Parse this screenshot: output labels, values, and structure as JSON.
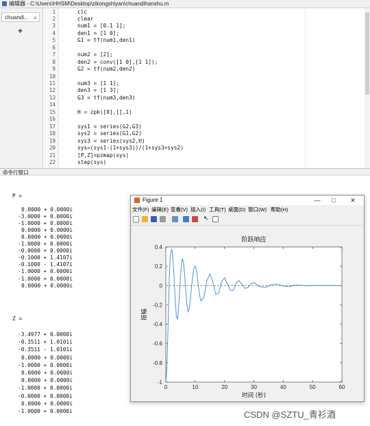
{
  "window": {
    "title": "编辑器 - C:\\Users\\HHSM\\Desktop\\zikongshiyan\\chuandihanshu.m",
    "tab_label": "chuandi...",
    "tab_close": "×",
    "add_tab": "+"
  },
  "editor": {
    "lines": [
      {
        "n": "1",
        "code": "clc"
      },
      {
        "n": "2",
        "code": "clear"
      },
      {
        "n": "3",
        "code": "num1 = [0.1 1];"
      },
      {
        "n": "4",
        "code": "den1 = [1 0];"
      },
      {
        "n": "5",
        "code": "G1 = tf(num1,den1)"
      },
      {
        "n": "6",
        "code": ""
      },
      {
        "n": "7",
        "code": "num2 = [2];"
      },
      {
        "n": "8",
        "code": "den2 = conv([1 0],[1 1]);"
      },
      {
        "n": "9",
        "code": "G2 = tf(num2,den2)"
      },
      {
        "n": "10",
        "code": ""
      },
      {
        "n": "11",
        "code": "num3 = [1 1];"
      },
      {
        "n": "12",
        "code": "den3 = [1 3];"
      },
      {
        "n": "13",
        "code": "G3 = tf(num3,den3)"
      },
      {
        "n": "14",
        "code": ""
      },
      {
        "n": "15",
        "code": "H = zpk([0],[],1)"
      },
      {
        "n": "16",
        "code": ""
      },
      {
        "n": "17",
        "code": "sys1 = series(G2,G3)"
      },
      {
        "n": "18",
        "code": "sys2 = series(G1,G2)"
      },
      {
        "n": "19",
        "code": "sys3 = series(sys2,H)"
      },
      {
        "n": "20",
        "code": "sys=(sys1-(1+sys3))/(1+sys3+sys2)"
      },
      {
        "n": "21",
        "code": "[P,Z]=pzmap(sys)"
      },
      {
        "n": "22",
        "code": "step(sys)"
      }
    ]
  },
  "command_window": {
    "title": "命令行窗口",
    "p_label": "P =",
    "p_values": [
      "0.0000 + 0.0000i",
      "-3.0000 + 0.0000i",
      "-1.0000 + 0.0000i",
      "0.0000 + 0.0000i",
      "0.0000 + 0.0000i",
      "-1.0000 + 0.0000i",
      "-0.0000 + 0.0000i",
      "-0.1000 + 1.4107i",
      "-0.1000 - 1.4107i",
      "-1.0000 + 0.0000i",
      "-1.0000 + 0.0000i",
      "0.0000 + 0.0000i"
    ],
    "z_label": "Z =",
    "z_values": [
      "-3.4977 + 0.0000i",
      "-0.3511 + 1.0101i",
      "-0.3511 - 1.0101i",
      "0.0000 + 0.0000i",
      "-1.0000 + 0.0000i",
      "0.0000 + 0.0000i",
      "0.0000 + 0.0000i",
      "-1.0000 + 0.0000i",
      "-0.0000 + 0.0000i",
      "0.0000 + 0.0000i",
      "-1.0000 + 0.0000i"
    ]
  },
  "figure": {
    "title": "Figure 1",
    "minimize": "—",
    "maximize": "□",
    "close": "✕",
    "menu": [
      "文件(F)",
      "编辑(E)",
      "查看(V)",
      "插入(I)",
      "工具(T)",
      "桌面(D)",
      "窗口(W)",
      "帮助(H)"
    ],
    "toolbar_icons": [
      "new-file-icon",
      "open-folder-icon",
      "save-icon",
      "print-icon",
      "link-plot-icon",
      "insert-colorbar-icon",
      "insert-legend-icon",
      "pointer-icon",
      "dock-icon"
    ]
  },
  "chart_data": {
    "type": "line",
    "title": "阶跃响应",
    "xlabel": "时间 (秒)",
    "ylabel": "振幅",
    "xlim": [
      0,
      60
    ],
    "ylim": [
      -1,
      0.4
    ],
    "xticks": [
      "0",
      "10",
      "20",
      "30",
      "40",
      "50",
      "60"
    ],
    "yticks": [
      "0.4",
      "0.2",
      "0",
      "-0.2",
      "-0.4",
      "-0.6",
      "-0.8",
      "-1"
    ],
    "color": "#4a90d9",
    "series": [
      {
        "x": [
          0,
          0.3,
          0.6,
          0.9,
          1.2,
          1.5,
          2.0,
          2.4,
          2.8,
          3.2,
          3.6,
          4.0,
          4.4,
          4.8,
          5.2,
          5.6,
          6.0,
          6.4,
          6.8,
          7.2,
          7.6,
          8.0,
          8.5,
          9.0,
          9.5,
          10.0,
          10.5,
          11.0,
          11.5,
          12.0,
          13.0,
          14.0,
          15.0,
          16.0,
          17.0,
          18.0,
          19.0,
          20.0,
          21.0,
          22.0,
          23.0,
          24.0,
          25.0,
          26.0,
          27.0,
          28.0,
          29.0,
          30.0,
          32.0,
          34.0,
          36.0,
          38.0,
          40.0,
          42.0,
          44.0,
          46.0,
          48.0,
          50.0,
          52.0,
          54.0,
          56.0,
          58.0,
          60.0
        ],
        "y": [
          -1,
          -0.9,
          -0.6,
          -0.25,
          0.1,
          0.3,
          0.38,
          0.3,
          0.1,
          -0.15,
          -0.32,
          -0.35,
          -0.22,
          0.0,
          0.18,
          0.28,
          0.25,
          0.12,
          -0.05,
          -0.2,
          -0.27,
          -0.24,
          -0.1,
          0.05,
          0.17,
          0.2,
          0.15,
          0.02,
          -0.1,
          -0.16,
          -0.12,
          0.05,
          0.12,
          0.04,
          -0.09,
          -0.08,
          0.04,
          0.08,
          0.02,
          -0.05,
          -0.05,
          0.03,
          0.05,
          0.01,
          -0.03,
          -0.02,
          0.02,
          0.03,
          -0.01,
          -0.02,
          0.01,
          0.015,
          -0.005,
          -0.01,
          0.005,
          0.004,
          -0.003,
          0.002,
          0.001,
          0,
          0,
          0,
          0
        ]
      }
    ]
  },
  "watermark": "CSDN @SZTU_青衫酒"
}
